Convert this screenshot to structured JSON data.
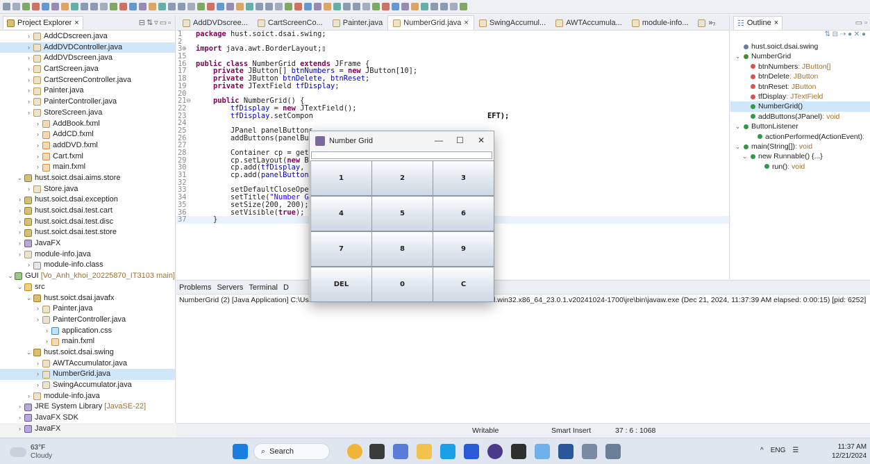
{
  "project_explorer": {
    "title": "Project Explorer",
    "items": [
      {
        "label": "AddCDscreen.java",
        "t": "j",
        "i": 1
      },
      {
        "label": "AddDVDController.java",
        "t": "j",
        "i": 1,
        "sel": true
      },
      {
        "label": "AddDVDscreen.java",
        "t": "j",
        "i": 1
      },
      {
        "label": "CartScreen.java",
        "t": "j",
        "i": 1
      },
      {
        "label": "CartScreenController.java",
        "t": "j",
        "i": 1
      },
      {
        "label": "Painter.java",
        "t": "j",
        "i": 1
      },
      {
        "label": "PainterController.java",
        "t": "j",
        "i": 1
      },
      {
        "label": "StoreScreen.java",
        "t": "j",
        "i": 1
      },
      {
        "label": "AddBook.fxml",
        "t": "f",
        "i": 2
      },
      {
        "label": "AddCD.fxml",
        "t": "f",
        "i": 2
      },
      {
        "label": "addDVD.fxml",
        "t": "f",
        "i": 2
      },
      {
        "label": "Cart.fxml",
        "t": "f",
        "i": 2
      },
      {
        "label": "main.fxml",
        "t": "f",
        "i": 2
      },
      {
        "label": "hust.soict.dsai.aims.store",
        "t": "p",
        "i": 0,
        "tw": "v"
      },
      {
        "label": "Store.java",
        "t": "j",
        "i": 1
      },
      {
        "label": "hust.soict.dsai.exception",
        "t": "p",
        "i": 0,
        "tw": ">"
      },
      {
        "label": "hust.soict.dsai.test.cart",
        "t": "p",
        "i": 0,
        "tw": ">"
      },
      {
        "label": "hust.soict.dsai.test.disc",
        "t": "p",
        "i": 0,
        "tw": ">"
      },
      {
        "label": "hust.soict.dsai.test.store",
        "t": "p",
        "i": 0,
        "tw": ">"
      },
      {
        "label": "JavaFX",
        "t": "l",
        "i": 0,
        "tw": ">"
      },
      {
        "label": "module-info.java",
        "t": "j",
        "i": 0,
        "tw": ">"
      },
      {
        "label": "module-info.class",
        "t": "m",
        "i": 1
      },
      {
        "label": "GUI",
        "extra": "[Vo_Anh_khoi_20225870_IT3103 main]",
        "t": "g",
        "i": -1,
        "tw": "v"
      },
      {
        "label": "src",
        "t": "s",
        "i": 0,
        "tw": "v"
      },
      {
        "label": "hust.soict.dsai.javafx",
        "t": "p",
        "i": 1,
        "tw": "v"
      },
      {
        "label": "Painter.java",
        "t": "j",
        "i": 2
      },
      {
        "label": "PainterController.java",
        "t": "j",
        "i": 2
      },
      {
        "label": "application.css",
        "t": "c",
        "i": 3
      },
      {
        "label": "main.fxml",
        "t": "f",
        "i": 3
      },
      {
        "label": "hust.soict.dsai.swing",
        "t": "p",
        "i": 1,
        "tw": "v"
      },
      {
        "label": "AWTAccumulator.java",
        "t": "j",
        "i": 2
      },
      {
        "label": "NumberGrid.java",
        "t": "j",
        "i": 2,
        "sel": true
      },
      {
        "label": "SwingAccumulator.java",
        "t": "j",
        "i": 2
      },
      {
        "label": "module-info.java",
        "t": "j",
        "i": 1
      },
      {
        "label": "JRE System Library",
        "extra": "[JavaSE-22]",
        "t": "l",
        "i": 0,
        "tw": ">"
      },
      {
        "label": "JavaFX SDK",
        "t": "l",
        "i": 0,
        "tw": ">"
      },
      {
        "label": "JavaFX",
        "t": "l",
        "i": 0,
        "tw": ">"
      }
    ]
  },
  "editor": {
    "tabs": [
      "AddDVDscree...",
      "CartScreenCo...",
      "Painter.java",
      "NumberGrid.java",
      "SwingAccumul...",
      "AWTAccumula...",
      "module-info...",
      "»₇"
    ],
    "active_tab": 3,
    "lines": [
      {
        "n": "1",
        "c": [
          [
            "kw",
            "package "
          ],
          [
            "",
            "hust.soict.dsai.swing;"
          ]
        ]
      },
      {
        "n": "2",
        "c": []
      },
      {
        "n": "3⊕",
        "c": [
          [
            "kw",
            "import "
          ],
          [
            "",
            "java.awt.BorderLayout;▯"
          ]
        ]
      },
      {
        "n": "15",
        "c": []
      },
      {
        "n": "16",
        "c": [
          [
            "kw",
            "public class "
          ],
          [
            "",
            "NumberGrid "
          ],
          [
            "kw",
            "extends "
          ],
          [
            "",
            "JFrame {"
          ]
        ]
      },
      {
        "n": "17",
        "c": [
          [
            "",
            "    "
          ],
          [
            "kw",
            "private "
          ],
          [
            "",
            "JButton[] "
          ],
          [
            "fd",
            "btnNumbers"
          ],
          [
            "",
            " = "
          ],
          [
            "kw",
            "new "
          ],
          [
            "",
            "JButton[10];"
          ]
        ]
      },
      {
        "n": "18",
        "c": [
          [
            "",
            "    "
          ],
          [
            "kw",
            "private "
          ],
          [
            "",
            "JButton "
          ],
          [
            "fd",
            "btnDelete"
          ],
          [
            "",
            ", "
          ],
          [
            "fd",
            "btnReset"
          ],
          [
            "",
            ";"
          ]
        ]
      },
      {
        "n": "19",
        "c": [
          [
            "",
            "    "
          ],
          [
            "kw",
            "private "
          ],
          [
            "",
            "JTextField "
          ],
          [
            "fd",
            "tfDisplay"
          ],
          [
            "",
            ";"
          ]
        ]
      },
      {
        "n": "20",
        "c": []
      },
      {
        "n": "21⊖",
        "c": [
          [
            "",
            "    "
          ],
          [
            "kw",
            "public "
          ],
          [
            "",
            "NumberGrid() {"
          ]
        ]
      },
      {
        "n": "22",
        "c": [
          [
            "",
            "        "
          ],
          [
            "fd",
            "tfDisplay"
          ],
          [
            "",
            " = "
          ],
          [
            "kw",
            "new "
          ],
          [
            "",
            "JTextField();"
          ]
        ]
      },
      {
        "n": "23",
        "c": [
          [
            "",
            "        "
          ],
          [
            "fd",
            "tfDisplay"
          ],
          [
            "",
            ".setCompon"
          ]
        ]
      },
      {
        "n": "24",
        "c": []
      },
      {
        "n": "25",
        "c": [
          [
            "",
            "        JPanel panelButtons"
          ]
        ]
      },
      {
        "n": "26",
        "c": [
          [
            "",
            "        addButtons(panelBut"
          ]
        ]
      },
      {
        "n": "27",
        "c": []
      },
      {
        "n": "28",
        "c": [
          [
            "",
            "        Container cp = getC"
          ]
        ]
      },
      {
        "n": "29",
        "c": [
          [
            "",
            "        cp.setLayout("
          ],
          [
            "kw",
            "new "
          ],
          [
            "",
            "Bo"
          ]
        ]
      },
      {
        "n": "30",
        "c": [
          [
            "",
            "        cp.add("
          ],
          [
            "fd",
            "tfDisplay"
          ],
          [
            "",
            ", B"
          ]
        ]
      },
      {
        "n": "31",
        "c": [
          [
            "",
            "        cp.add("
          ],
          [
            "fd",
            "panelButtons"
          ]
        ]
      },
      {
        "n": "32",
        "c": []
      },
      {
        "n": "33",
        "c": [
          [
            "",
            "        setDefaultCloseOper"
          ]
        ]
      },
      {
        "n": "34",
        "c": [
          [
            "",
            "        setTitle("
          ],
          [
            "st",
            "\"Number Gr"
          ]
        ]
      },
      {
        "n": "35",
        "c": [
          [
            "",
            "        setSize(200, 200);"
          ]
        ]
      },
      {
        "n": "36",
        "c": [
          [
            "",
            "        setVisible("
          ],
          [
            "kw",
            "true"
          ],
          [
            "",
            ");"
          ]
        ]
      },
      {
        "n": "37",
        "c": [
          [
            "",
            "    }"
          ]
        ]
      }
    ],
    "line23_tail": "EFT);"
  },
  "console": {
    "tabs": [
      "Problems",
      "Servers",
      "Terminal",
      "D"
    ],
    "status_left": "NumberGrid (2) [Java Application] C:\\Users\\",
    "status_right": "l.win32.x86_64_23.0.1.v20241024-1700\\jre\\bin\\javaw.exe  (Dec 21, 2024, 11:37:39 AM elapsed: 0:00:15) [pid: 6252]"
  },
  "outline": {
    "title": "Outline",
    "items": [
      {
        "label": "hust.soict.dsai.swing",
        "i": 0,
        "d": "#6b7a9a"
      },
      {
        "label": "NumberGrid",
        "i": 0,
        "d": "#4a8a2e",
        "tw": "v"
      },
      {
        "label": "btnNumbers",
        "type": " : JButton[]",
        "i": 1,
        "d": "#d9534f"
      },
      {
        "label": "btnDelete",
        "type": " : JButton",
        "i": 1,
        "d": "#d9534f"
      },
      {
        "label": "btnReset",
        "type": " : JButton",
        "i": 1,
        "d": "#d9534f"
      },
      {
        "label": "tfDisplay",
        "type": " : JTextField",
        "i": 1,
        "d": "#d9534f"
      },
      {
        "label": "NumberGrid()",
        "i": 1,
        "d": "#2e9a45",
        "sel": true
      },
      {
        "label": "addButtons(JPanel)",
        "type": " : void",
        "i": 1,
        "d": "#2e9a45"
      },
      {
        "label": "ButtonListener",
        "i": 0,
        "d": "#2e9a45",
        "tw": "v"
      },
      {
        "label": "actionPerformed(ActionEvent)",
        "type": " :",
        "i": 2,
        "d": "#2e9a45"
      },
      {
        "label": "main(String[])",
        "type": " : void",
        "i": 0,
        "d": "#2e9a45",
        "tw": "v"
      },
      {
        "label": "new Runnable() {...}",
        "i": 1,
        "d": "#2e9a45",
        "tw": "v"
      },
      {
        "label": "run()",
        "type": " : void",
        "i": 3,
        "d": "#2e9a45"
      }
    ]
  },
  "statusbar": {
    "writable": "Writable",
    "insert": "Smart Insert",
    "position": "37 : 6 : 1068"
  },
  "taskbar": {
    "weather_temp": "63°F",
    "weather_desc": "Cloudy",
    "search": "Search",
    "lang": "ENG",
    "time": "11:37 AM",
    "date": "12/21/2024"
  },
  "number_grid_window": {
    "title": "Number Grid",
    "buttons": [
      "1",
      "2",
      "3",
      "4",
      "5",
      "6",
      "7",
      "8",
      "9",
      "DEL",
      "0",
      "C"
    ]
  },
  "colors": {
    "accent": "#0078d4",
    "selection": "#cfe6fb"
  }
}
